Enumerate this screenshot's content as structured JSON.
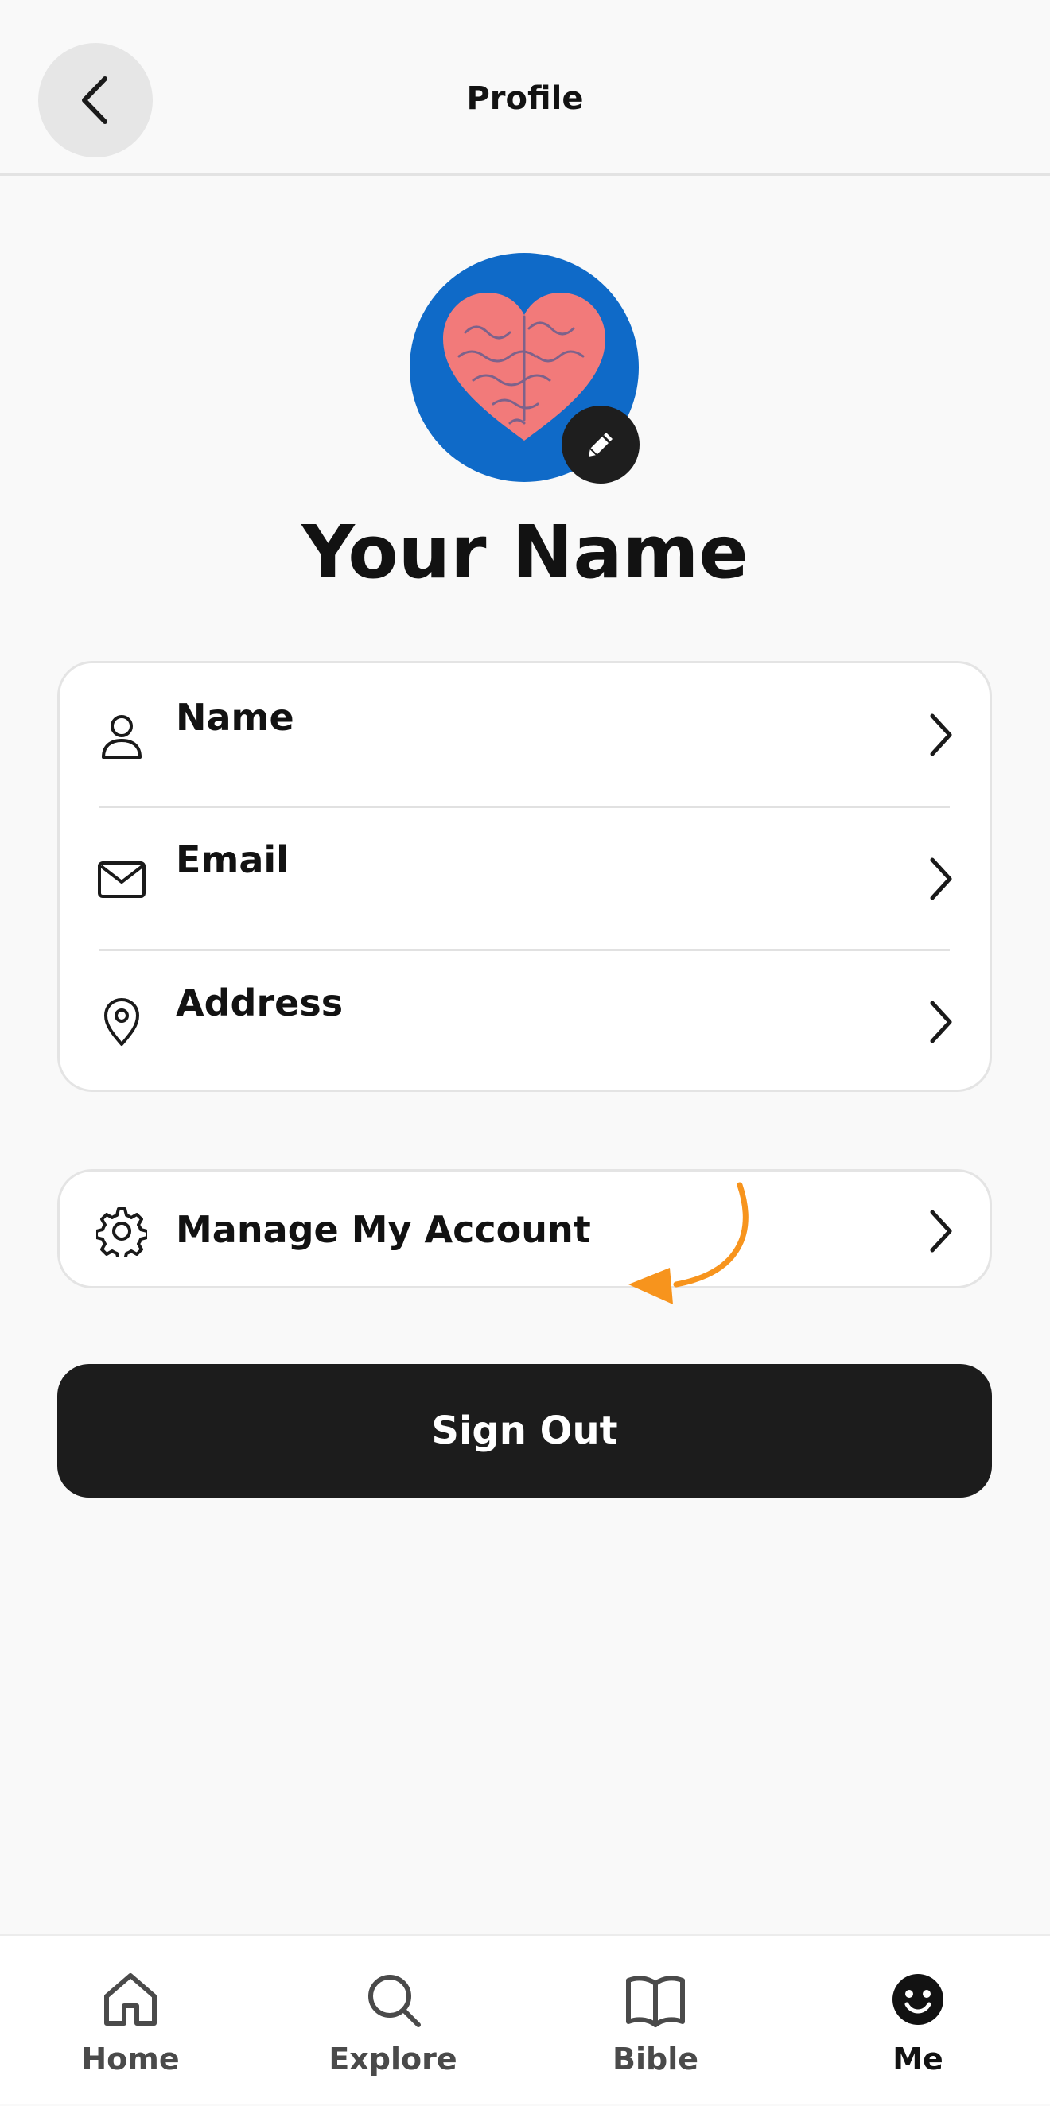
{
  "header": {
    "title": "Profile",
    "back_icon": "chevron-left-icon"
  },
  "profile": {
    "display_name": "Your Name",
    "avatar_colors": {
      "background": "#0f6ac8",
      "heart": "#f27a7a"
    },
    "edit_icon": "pencil-icon"
  },
  "info_rows": [
    {
      "label": "Name",
      "icon": "person-icon"
    },
    {
      "label": "Email",
      "icon": "envelope-icon"
    },
    {
      "label": "Address",
      "icon": "location-pin-icon"
    }
  ],
  "account": {
    "label": "Manage My Account",
    "icon": "gear-icon"
  },
  "annotation": {
    "color": "#f7941d",
    "icon": "curved-arrow-icon"
  },
  "sign_out": {
    "label": "Sign Out"
  },
  "bottom_nav": {
    "items": [
      {
        "label": "Home",
        "icon": "home-icon",
        "active": false
      },
      {
        "label": "Explore",
        "icon": "search-icon",
        "active": false
      },
      {
        "label": "Bible",
        "icon": "book-icon",
        "active": false
      },
      {
        "label": "Me",
        "icon": "smiley-icon",
        "active": true
      }
    ]
  }
}
